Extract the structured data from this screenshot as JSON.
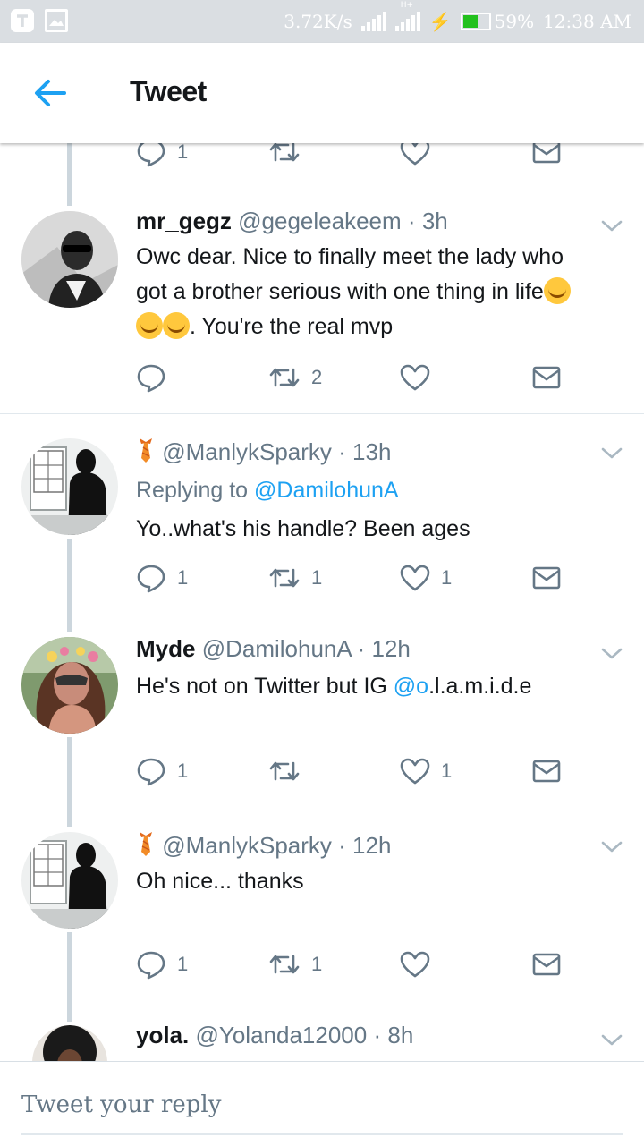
{
  "status_bar": {
    "speed": "3.72K/s",
    "network": "H+",
    "battery": "59%",
    "time": "12:38 AM"
  },
  "header": {
    "title": "Tweet"
  },
  "colors": {
    "accent": "#1da1f2",
    "secondary_text": "#657786",
    "thread_line": "#ccd6dd"
  },
  "top_actions": {
    "reply_count": "1"
  },
  "tweets": [
    {
      "name": "mr_gegz",
      "handle": "@gegeleakeem",
      "dot": "·",
      "time": "3h",
      "text_line1": "Owc dear. Nice to finally meet the lady who",
      "text_line2": "got a brother serious with one thing in life",
      "text_line3": ". You're the real mvp",
      "reply_count": "",
      "retweet_count": "2",
      "like_count": ""
    },
    {
      "name": "",
      "handle": "@ManlykSparky",
      "dot": "·",
      "time": "13h",
      "replying_prefix": "Replying to",
      "replying_to": "@DamilohunA",
      "text": "Yo..what's his handle? Been ages",
      "reply_count": "1",
      "retweet_count": "1",
      "like_count": "1"
    },
    {
      "name": "Myde",
      "handle": "@DamilohunA",
      "dot": "·",
      "time": "12h",
      "text_prefix": "He's not on Twitter but IG ",
      "text_link": "@o",
      "text_suffix": ".l.a.m.i.d.e",
      "reply_count": "1",
      "retweet_count": "",
      "like_count": "1"
    },
    {
      "name": "",
      "handle": "@ManlykSparky",
      "dot": "·",
      "time": "12h",
      "text": "Oh nice... thanks",
      "reply_count": "1",
      "retweet_count": "1",
      "like_count": ""
    },
    {
      "name": "yola.",
      "handle": "@Yolanda12000",
      "dot": "·",
      "time": "8h"
    }
  ],
  "reply_bar": {
    "placeholder": "Tweet your reply"
  }
}
